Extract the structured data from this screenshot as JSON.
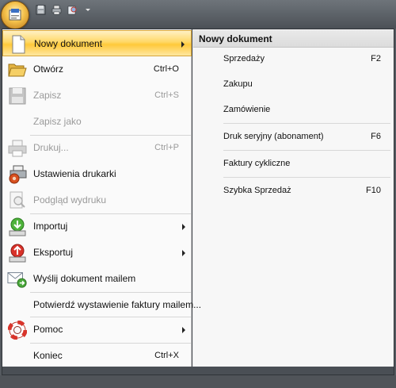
{
  "quick_access": {
    "icons": [
      "save-icon",
      "print-icon",
      "preview-icon",
      "customize-dropdown-icon"
    ]
  },
  "app_menu": {
    "items": [
      {
        "label": "Nowy dokument",
        "shortcut": "",
        "icon": "new-document-icon",
        "submenu": true,
        "state": "selected"
      },
      {
        "label": "Otwórz",
        "shortcut": "Ctrl+O",
        "icon": "open-folder-icon",
        "submenu": false,
        "state": "enabled"
      },
      {
        "label": "Zapisz",
        "shortcut": "Ctrl+S",
        "icon": "save-disk-icon",
        "submenu": false,
        "state": "disabled"
      },
      {
        "label": "Zapisz jako",
        "shortcut": "",
        "icon": "",
        "submenu": false,
        "state": "disabled"
      },
      {
        "label": "Drukuj...",
        "shortcut": "Ctrl+P",
        "icon": "printer-icon",
        "submenu": false,
        "state": "disabled"
      },
      {
        "label": "Ustawienia drukarki",
        "shortcut": "",
        "icon": "printer-settings-icon",
        "submenu": false,
        "state": "enabled"
      },
      {
        "label": "Podgląd wydruku",
        "shortcut": "",
        "icon": "print-preview-icon",
        "submenu": false,
        "state": "disabled"
      },
      {
        "label": "Importuj",
        "shortcut": "",
        "icon": "import-icon",
        "submenu": true,
        "state": "enabled"
      },
      {
        "label": "Eksportuj",
        "shortcut": "",
        "icon": "export-icon",
        "submenu": true,
        "state": "enabled"
      },
      {
        "label": "Wyślij dokument mailem",
        "shortcut": "",
        "icon": "email-send-icon",
        "submenu": false,
        "state": "enabled"
      },
      {
        "label": "Potwierdź wystawienie faktury mailem...",
        "shortcut": "",
        "icon": "",
        "submenu": false,
        "state": "enabled"
      },
      {
        "label": "Pomoc",
        "shortcut": "",
        "icon": "lifebuoy-icon",
        "submenu": true,
        "state": "enabled"
      },
      {
        "label": "Koniec",
        "shortcut": "Ctrl+X",
        "icon": "",
        "submenu": false,
        "state": "enabled"
      }
    ]
  },
  "submenu": {
    "title": "Nowy dokument",
    "items": [
      {
        "label": "Sprzedaży",
        "shortcut": "F2"
      },
      {
        "label": "Zakupu",
        "shortcut": ""
      },
      {
        "label": "Zamówienie",
        "shortcut": ""
      },
      {
        "label": "Druk seryjny (abonament)",
        "shortcut": "F6"
      },
      {
        "label": "Faktury cykliczne",
        "shortcut": ""
      },
      {
        "label": "Szybka Sprzedaż",
        "shortcut": "F10"
      }
    ]
  },
  "colors": {
    "highlight": "#ffd866",
    "chrome": "#4c5157",
    "disabled_text": "#9a9a9a"
  }
}
